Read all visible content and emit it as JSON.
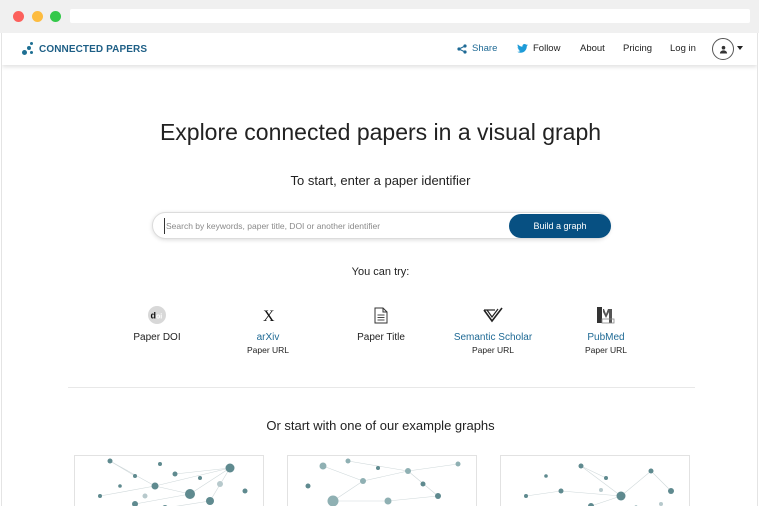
{
  "brand": {
    "name": "CONNECTED PAPERS",
    "color": "#1e5f86"
  },
  "nav": {
    "share": "Share",
    "follow": "Follow",
    "about": "About",
    "pricing": "Pricing",
    "login": "Log in"
  },
  "hero": {
    "title": "Explore connected papers in a visual graph",
    "subtitle": "To start, enter a paper identifier"
  },
  "search": {
    "placeholder": "Search by keywords, paper title, DOI or another identifier",
    "value": "",
    "button": "Build a graph"
  },
  "try": {
    "label": "You can try:",
    "items": [
      {
        "icon": "doi-icon",
        "main": "Paper DOI",
        "sub": ""
      },
      {
        "icon": "arxiv-icon",
        "main": "arXiv",
        "sub": "Paper URL"
      },
      {
        "icon": "document-icon",
        "main": "Paper Title",
        "sub": ""
      },
      {
        "icon": "semantic-scholar-icon",
        "main": "Semantic Scholar",
        "sub": "Paper URL"
      },
      {
        "icon": "pubmed-icon",
        "main": "PubMed",
        "sub": "Paper URL"
      }
    ]
  },
  "examples": {
    "label": "Or start with one of our example graphs"
  },
  "colors": {
    "accent": "#075082",
    "link": "#1f6a95",
    "node": "#5f8a8f"
  }
}
